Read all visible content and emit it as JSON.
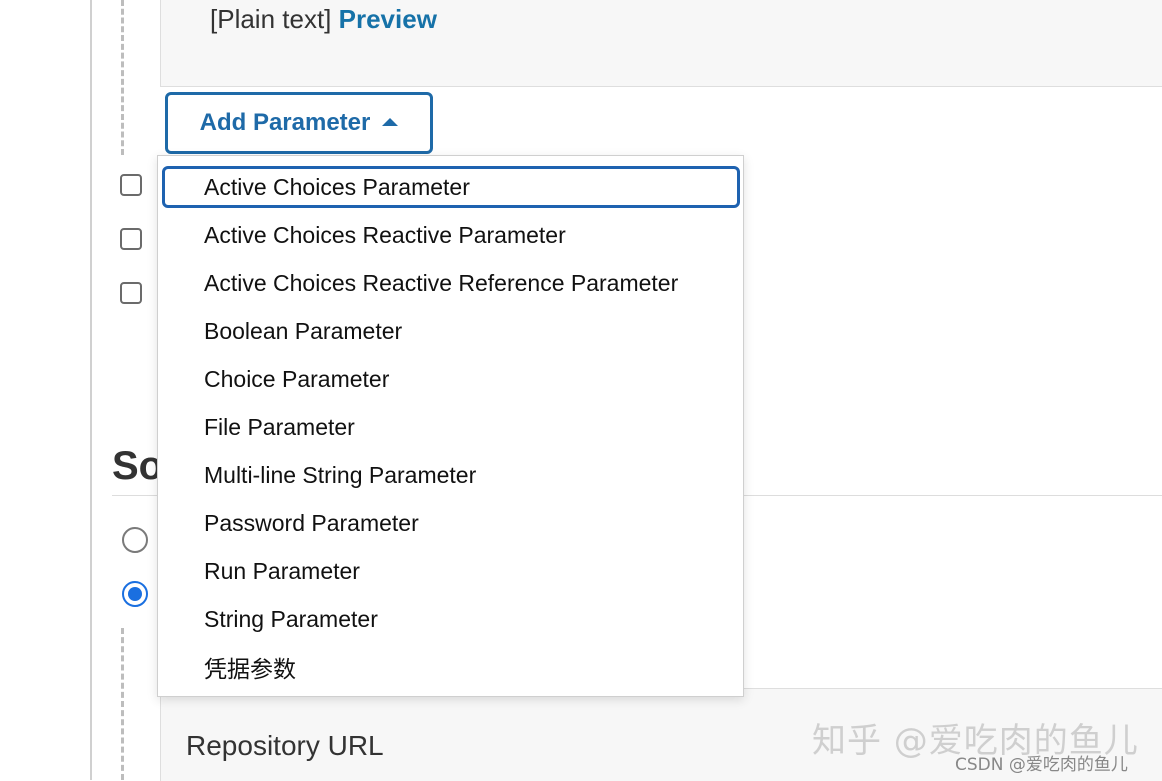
{
  "top_panel": {
    "plain_text_label": "[Plain text]",
    "preview_link": "Preview"
  },
  "add_parameter": {
    "label": "Add Parameter",
    "icon": "caret-up-icon"
  },
  "parameter_menu": {
    "items": [
      {
        "label": "Active Choices Parameter",
        "focused": true
      },
      {
        "label": "Active Choices Reactive Parameter"
      },
      {
        "label": "Active Choices Reactive Reference Parameter"
      },
      {
        "label": "Boolean Parameter"
      },
      {
        "label": "Choice Parameter"
      },
      {
        "label": "File Parameter"
      },
      {
        "label": "Multi-line String Parameter"
      },
      {
        "label": "Password Parameter"
      },
      {
        "label": "Run Parameter"
      },
      {
        "label": "String Parameter"
      },
      {
        "label": "凭据参数"
      }
    ]
  },
  "options": {
    "checkboxes": [
      {
        "checked": false
      },
      {
        "checked": false
      },
      {
        "checked": false
      }
    ]
  },
  "source_section": {
    "heading_visible": "So",
    "radios": [
      {
        "selected": false
      },
      {
        "selected": true
      }
    ],
    "repository_url_label": "Repository URL"
  },
  "watermark": {
    "main": "知乎 @爱吃肉的鱼儿",
    "sub": "CSDN @爱吃肉的鱼儿"
  },
  "colors": {
    "accent": "#1e6aa8",
    "link": "#1672a8",
    "radio_selected": "#1a6fe0"
  }
}
